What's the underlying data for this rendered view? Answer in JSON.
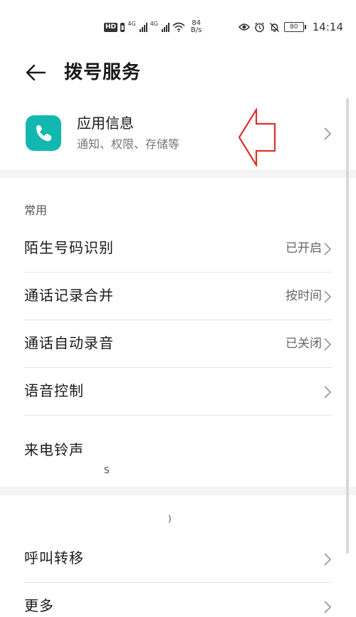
{
  "status_bar": {
    "hd_badge": "HD",
    "sim1_label": "4G",
    "sim2_label": "4G",
    "speed_value": "84",
    "speed_unit": "B/s",
    "battery": "80",
    "time": "14:14"
  },
  "header": {
    "title": "拨号服务"
  },
  "app_info": {
    "title": "应用信息",
    "subtitle": "通知、权限、存储等",
    "icon_color": "#12b8b0"
  },
  "section_common": {
    "label": "常用",
    "items": [
      {
        "label": "陌生号码识别",
        "value": "已开启"
      },
      {
        "label": "通话记录合并",
        "value": "按时间"
      },
      {
        "label": "通话自动录音",
        "value": "已关闭"
      },
      {
        "label": "语音控制",
        "value": ""
      },
      {
        "label": "来电铃声",
        "value": ""
      }
    ]
  },
  "overlay_fragments": {
    "fragment_1": "S",
    "fragment_2": ")"
  },
  "section_other": {
    "items": [
      {
        "label": "呼叫转移"
      },
      {
        "label": "更多"
      }
    ]
  },
  "colors": {
    "accent_annotation": "#d9342b",
    "divider": "#e3e3e3",
    "gap": "#f4f4f4"
  }
}
